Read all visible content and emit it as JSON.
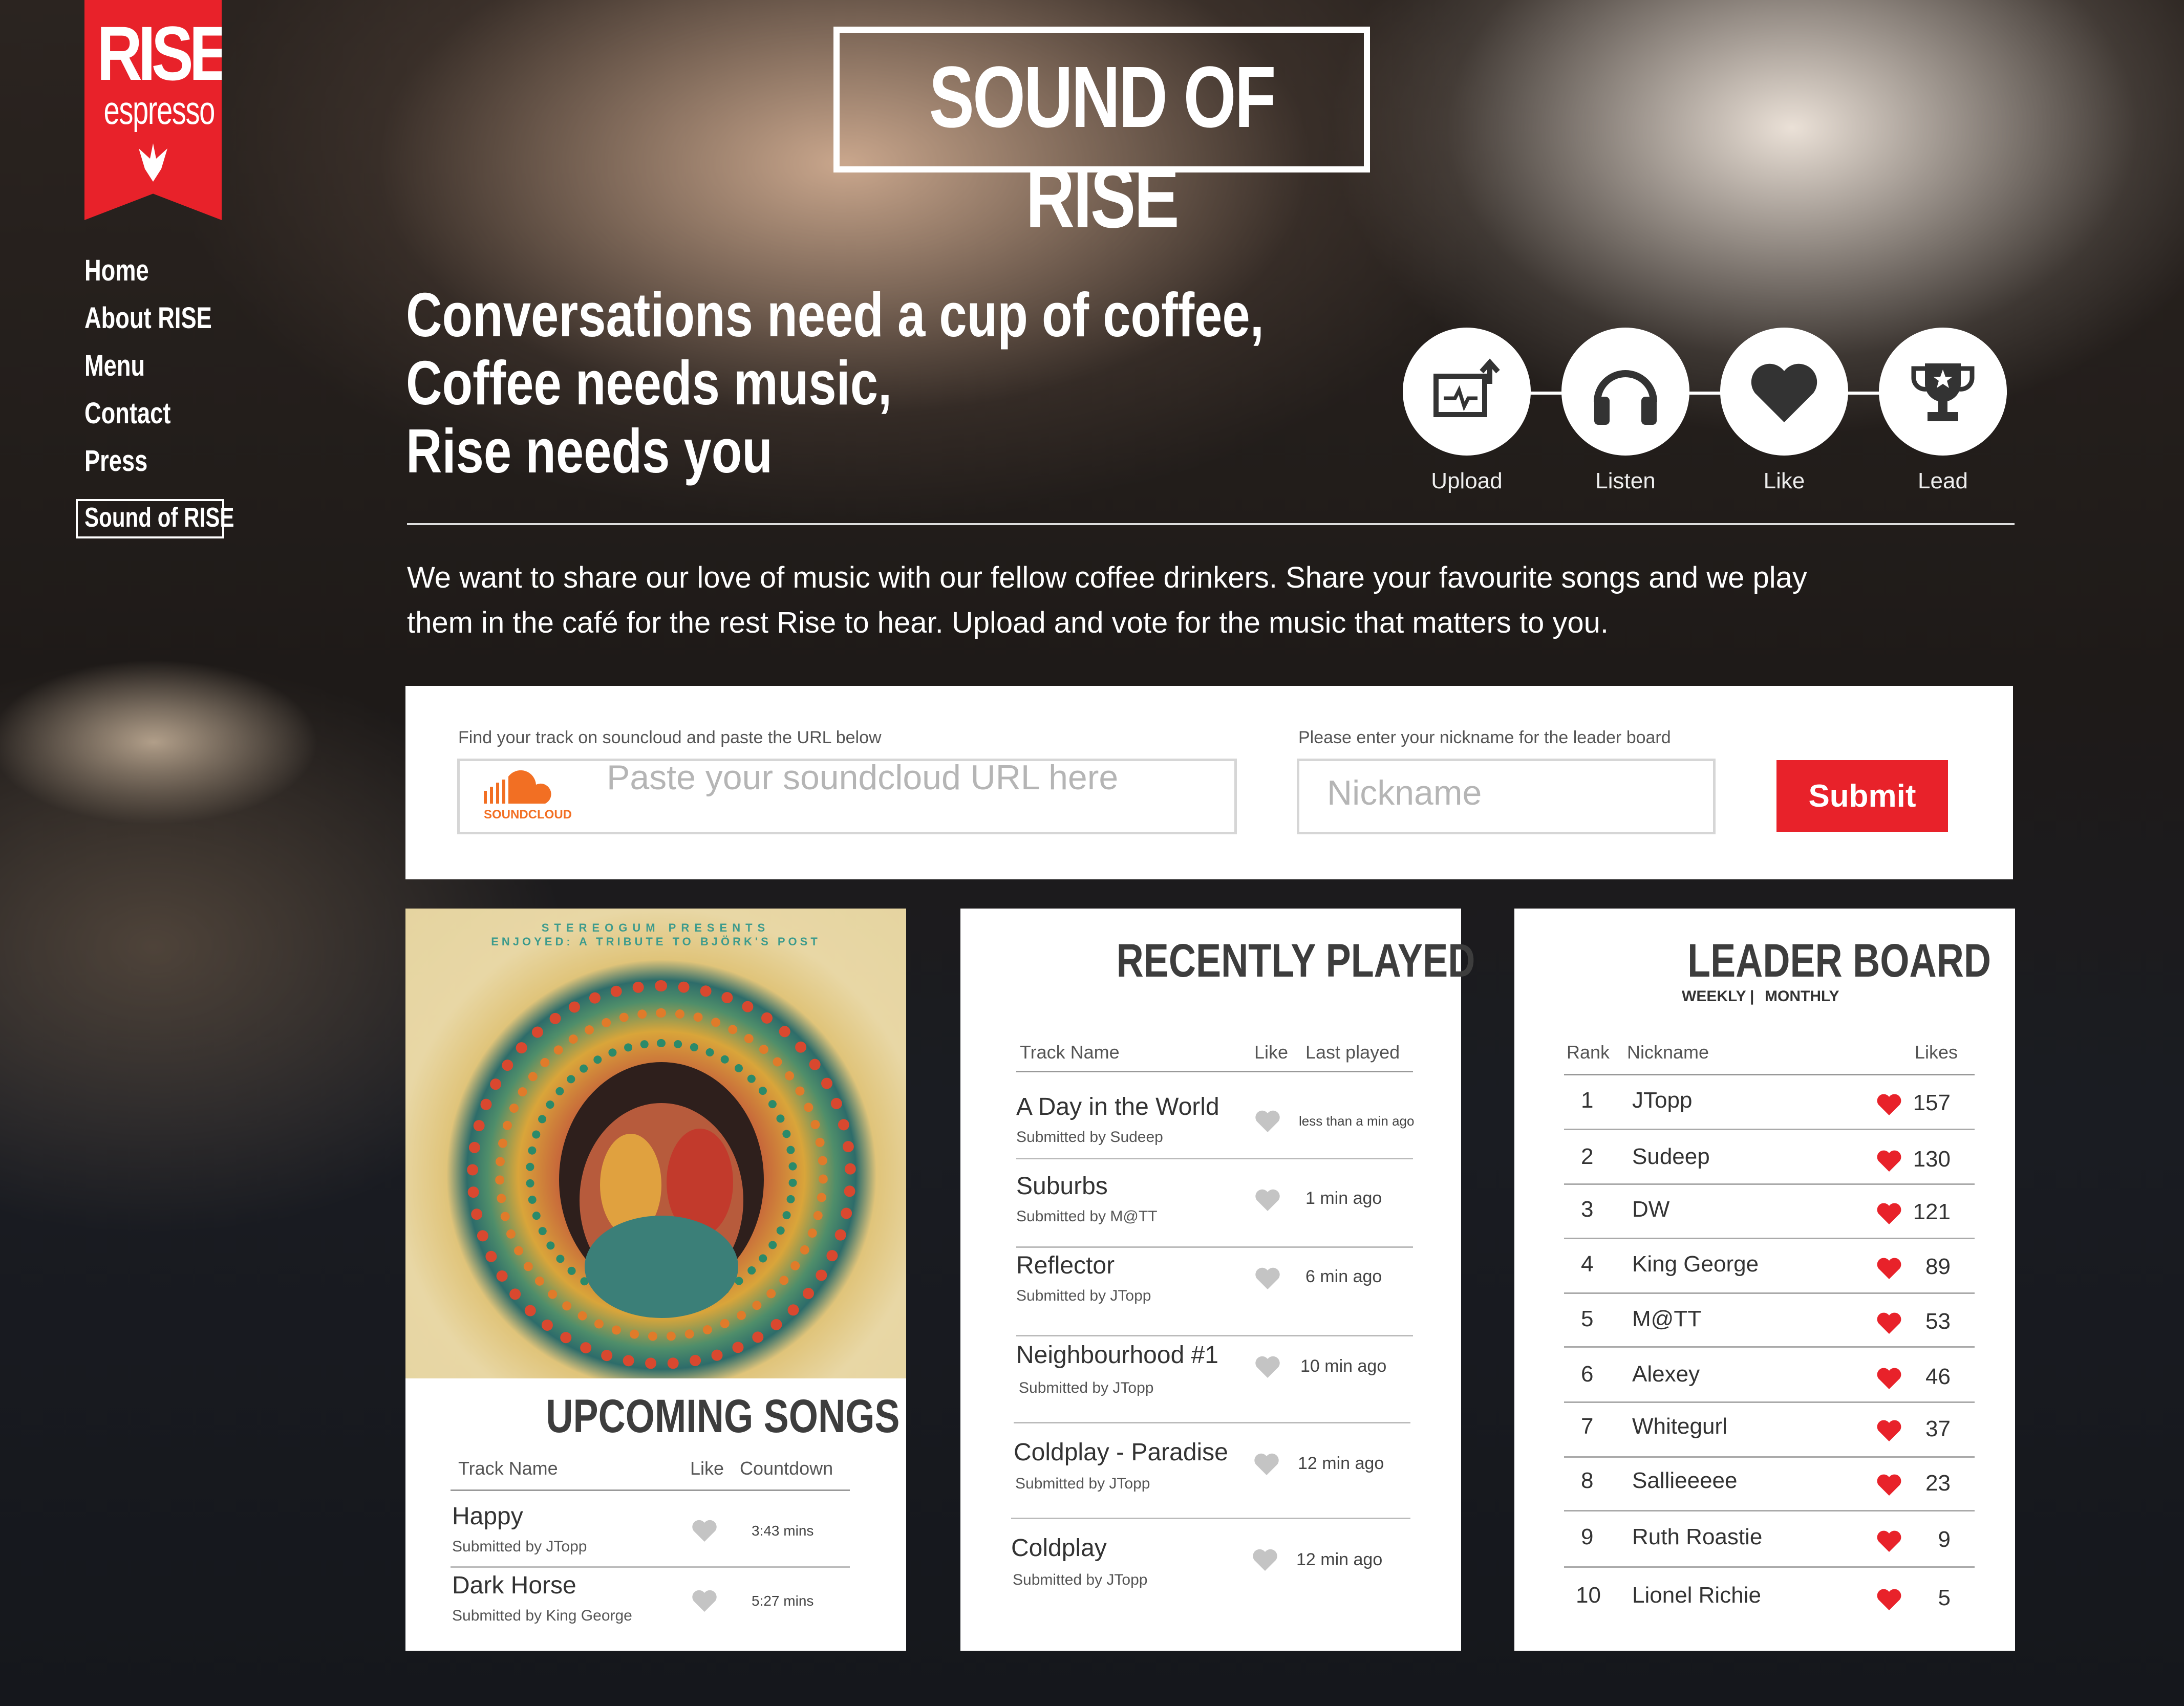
{
  "brand": {
    "name": "RISE",
    "sub": "espresso"
  },
  "nav": {
    "items": [
      "Home",
      "About RISE",
      "Menu",
      "Contact",
      "Press"
    ],
    "active": "Sound of RISE"
  },
  "page_title": "SOUND OF RISE",
  "headline": {
    "line1": "Conversations need a cup of coffee,",
    "line2": "Coffee needs music,",
    "line3": "Rise needs you"
  },
  "steps": [
    {
      "label": "Upload",
      "icon": "upload-icon"
    },
    {
      "label": "Listen",
      "icon": "headphones-icon"
    },
    {
      "label": "Like",
      "icon": "heart-icon"
    },
    {
      "label": "Lead",
      "icon": "trophy-icon"
    }
  ],
  "intro": {
    "line1": "We want to share our love of music with our fellow coffee drinkers.  Share your favourite songs and we play",
    "line2": "them in the café for the rest Rise to hear.  Upload and vote for the music that matters to you."
  },
  "form": {
    "url_label": "Find your track on souncloud and paste the URL below",
    "url_placeholder": "Paste your soundcloud URL here",
    "soundcloud_text": "SOUNDCLOUD",
    "nickname_label": "Please enter your nickname for the leader board",
    "nickname_placeholder": "Nickname",
    "submit_label": "Submit"
  },
  "album": {
    "presents": "STEREOGUM PRESENTS",
    "title": "ENJOYED: A TRIBUTE TO BJÖRK'S POST"
  },
  "upcoming": {
    "title": "UPCOMING SONGS",
    "headers": {
      "track": "Track Name",
      "like": "Like",
      "countdown": "Countdown"
    },
    "rows": [
      {
        "track": "Happy",
        "submitted": "Submitted by JTopp",
        "countdown": "3:43 mins"
      },
      {
        "track": "Dark Horse",
        "submitted": "Submitted by King George",
        "countdown": "5:27 mins"
      }
    ]
  },
  "recent": {
    "title": "RECENTLY PLAYED",
    "headers": {
      "track": "Track Name",
      "like": "Like",
      "last": "Last played"
    },
    "rows": [
      {
        "track": "A Day in the World",
        "submitted": "Submitted by Sudeep",
        "time": "less than a min ago"
      },
      {
        "track": "Suburbs",
        "submitted": "Submitted by M@TT",
        "time": "1 min ago"
      },
      {
        "track": "Reflector",
        "submitted": "Submitted by JTopp",
        "time": "6 min ago"
      },
      {
        "track": "Neighbourhood #1",
        "submitted": "Submitted by JTopp",
        "time": "10 min ago"
      },
      {
        "track": "Coldplay - Paradise",
        "submitted": "Submitted by JTopp",
        "time": "12 min ago"
      },
      {
        "track": "Coldplay",
        "submitted": "Submitted by JTopp",
        "time": "12 min ago"
      }
    ]
  },
  "leaderboard": {
    "title": "LEADER BOARD",
    "weekly": "WEEKLY",
    "sep": "|",
    "monthly": "MONTHLY",
    "headers": {
      "rank": "Rank",
      "nickname": "Nickname",
      "likes": "Likes"
    },
    "rows": [
      {
        "rank": "1",
        "nickname": "JTopp",
        "likes": "157"
      },
      {
        "rank": "2",
        "nickname": "Sudeep",
        "likes": "130"
      },
      {
        "rank": "3",
        "nickname": "DW",
        "likes": "121"
      },
      {
        "rank": "4",
        "nickname": "King George",
        "likes": "89"
      },
      {
        "rank": "5",
        "nickname": "M@TT",
        "likes": "53"
      },
      {
        "rank": "6",
        "nickname": "Alexey",
        "likes": "46"
      },
      {
        "rank": "7",
        "nickname": "Whitegurl",
        "likes": "37"
      },
      {
        "rank": "8",
        "nickname": "Sallieeeee",
        "likes": "23"
      },
      {
        "rank": "9",
        "nickname": "Ruth Roastie",
        "likes": "9"
      },
      {
        "rank": "10",
        "nickname": "Lionel Richie",
        "likes": "5"
      }
    ]
  },
  "colors": {
    "accent": "#e8222a",
    "panel": "#ffffff",
    "heart_grey": "#c4c4c4"
  }
}
